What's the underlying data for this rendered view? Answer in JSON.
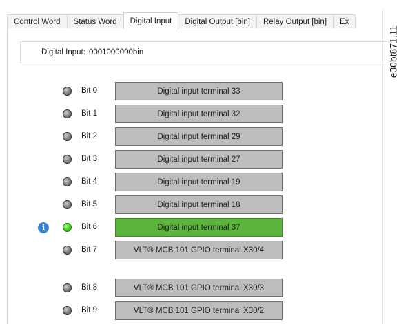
{
  "tabs": [
    {
      "label": "Control Word",
      "active": false
    },
    {
      "label": "Status Word",
      "active": false
    },
    {
      "label": "Digital Input",
      "active": true
    },
    {
      "label": "Digital Output [bin]",
      "active": false
    },
    {
      "label": "Relay Output [bin]",
      "active": false
    },
    {
      "label": "Ex",
      "active": false
    }
  ],
  "digital_input": {
    "label": "Digital Input:",
    "value": "0001000000bin"
  },
  "bits": [
    {
      "bit": "Bit 0",
      "terminal": "Digital input terminal 33",
      "on": false,
      "info": false
    },
    {
      "bit": "Bit 1",
      "terminal": "Digital input terminal 32",
      "on": false,
      "info": false
    },
    {
      "bit": "Bit 2",
      "terminal": "Digital input terminal 29",
      "on": false,
      "info": false
    },
    {
      "bit": "Bit 3",
      "terminal": "Digital input terminal 27",
      "on": false,
      "info": false
    },
    {
      "bit": "Bit 4",
      "terminal": "Digital input terminal 19",
      "on": false,
      "info": false
    },
    {
      "bit": "Bit 5",
      "terminal": "Digital input terminal 18",
      "on": false,
      "info": false
    },
    {
      "bit": "Bit 6",
      "terminal": "Digital input terminal 37",
      "on": true,
      "info": true
    },
    {
      "bit": "Bit 7",
      "terminal": "VLT® MCB 101 GPIO terminal X30/4",
      "on": false,
      "info": false
    },
    {
      "bit": "Bit 8",
      "terminal": "VLT® MCB 101 GPIO terminal X30/3",
      "on": false,
      "info": false
    },
    {
      "bit": "Bit 9",
      "terminal": "VLT® MCB 101 GPIO terminal X30/2",
      "on": false,
      "info": false
    }
  ],
  "info_icon_glyph": "i",
  "side_code": "e30bt871.11",
  "colors": {
    "led_on": "#46d21e",
    "led_off": "#6e6e6e",
    "button_on": "#5bb53c",
    "button_off": "#bdbdbd",
    "info_icon": "#3a86d6"
  }
}
